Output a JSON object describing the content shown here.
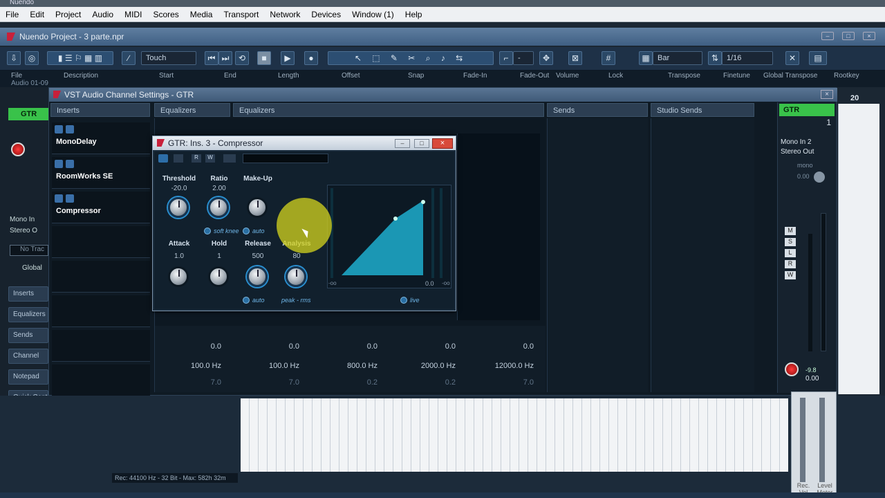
{
  "app_title": "Nuendo",
  "menu": [
    "File",
    "Edit",
    "Project",
    "Audio",
    "MIDI",
    "Scores",
    "Media",
    "Transport",
    "Network",
    "Devices",
    "Window (1)",
    "Help"
  ],
  "project_title": "Nuendo Project - 3 parte.npr",
  "toolbar": {
    "automation_mode": "Touch",
    "grid_type": "Bar",
    "quantize": "1/16"
  },
  "infoline": {
    "headers": [
      "File",
      "Description",
      "Start",
      "End",
      "Length",
      "Offset",
      "Snap",
      "Fade-In",
      "Fade-Out",
      "Volume",
      "Lock",
      "Transpose",
      "Finetune",
      "Global Transpose",
      "Rootkey"
    ],
    "file_value": "Audio 01-09"
  },
  "left_panel": {
    "track_name": "GTR",
    "routing_in": "Mono In",
    "routing_out": "Stereo O",
    "no_track": "No Trac",
    "global": "Global",
    "tabs": [
      "Inserts",
      "Equalizers",
      "Sends",
      "Channel",
      "Notepad",
      "Quick Cont"
    ]
  },
  "vst_window": {
    "title": "VST Audio Channel Settings - GTR",
    "sections": {
      "inserts": "Inserts",
      "equalizers": "Equalizers",
      "eq_curve": "Equalizers",
      "sends": "Sends",
      "studio_sends": "Studio Sends"
    },
    "inserts": [
      "MonoDelay",
      "RoomWorks SE",
      "Compressor"
    ],
    "eq_bands": [
      {
        "gain": "0.0",
        "freq": "100.0 Hz",
        "q": "7.0"
      },
      {
        "gain": "0.0",
        "freq": "100.0 Hz",
        "q": "7.0"
      },
      {
        "gain": "0.0",
        "freq": "800.0 Hz",
        "q": "0.2"
      },
      {
        "gain": "0.0",
        "freq": "2000.0 Hz",
        "q": "0.2"
      },
      {
        "gain": "0.0",
        "freq": "12000.0 Hz",
        "q": "7.0"
      }
    ],
    "eq_extra_q": "0.2"
  },
  "channel_strip": {
    "name": "GTR",
    "number": "1",
    "input": "Mono In 2",
    "output": "Stereo Out",
    "mono_label": "mono",
    "pan_value": "0.00",
    "fader_value": "0.00",
    "peak_value": "-9.8"
  },
  "compressor": {
    "title": "GTR: Ins. 3 - Compressor",
    "knobs_top": [
      {
        "label": "Threshold",
        "value": "-20.0"
      },
      {
        "label": "Ratio",
        "value": "2.00"
      },
      {
        "label": "Make-Up",
        "value": ""
      }
    ],
    "knobs_bottom": [
      {
        "label": "Attack",
        "value": "1.0"
      },
      {
        "label": "Hold",
        "value": "1"
      },
      {
        "label": "Release",
        "value": "500"
      },
      {
        "label": "Analysis",
        "value": "80"
      }
    ],
    "options": {
      "soft_knee": "soft knee",
      "auto_makeup": "auto",
      "auto_release": "auto",
      "peak_rms": "peak - rms",
      "live": "live"
    },
    "graph_labels": {
      "neg_inf": "-oo",
      "zero": "0.0",
      "neg_inf_right": "-oo"
    }
  },
  "status_bar": "Rec: 44100 Hz - 32 Bit - Max: 582h 32m",
  "bottom_labels": {
    "rec_vol": "Rec. Vol",
    "level_meter": "Level Meter"
  },
  "ruler_number": "20",
  "colors": {
    "accent_green": "#39c24a",
    "highlight_yellow": "#cdcd1e",
    "record_red": "#ff3b3b"
  }
}
